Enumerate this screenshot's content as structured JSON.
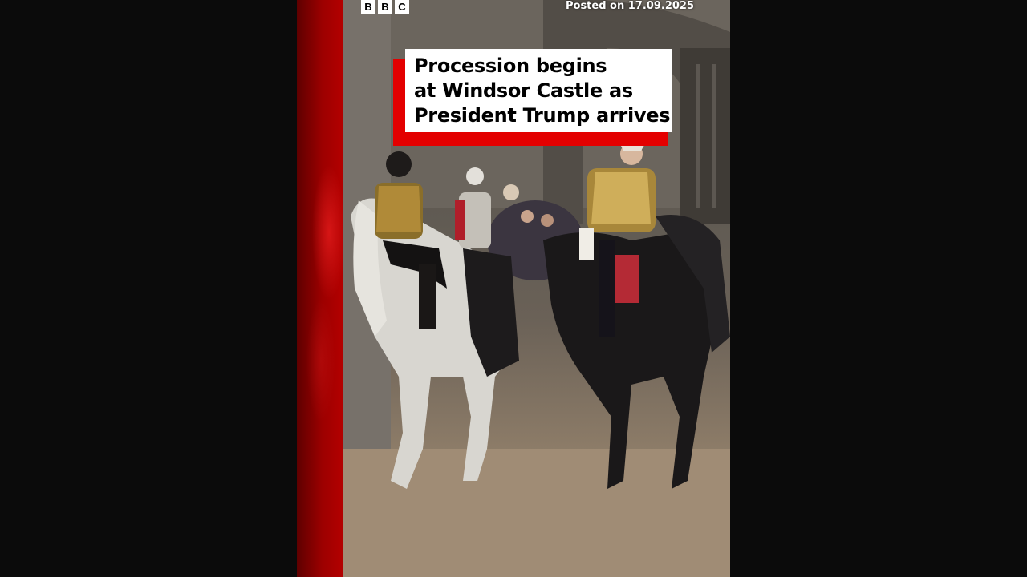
{
  "brand": {
    "logo_letters": [
      "B",
      "B",
      "C"
    ]
  },
  "posted_label": "Posted on 17.09.2025",
  "headline": {
    "lines": [
      "Procession begins",
      "at Windsor Castle as",
      "President Trump arrives"
    ]
  },
  "colors": {
    "accent_red": "#e30000",
    "band_red": "#9c0000",
    "background": "#0b0b0b"
  }
}
